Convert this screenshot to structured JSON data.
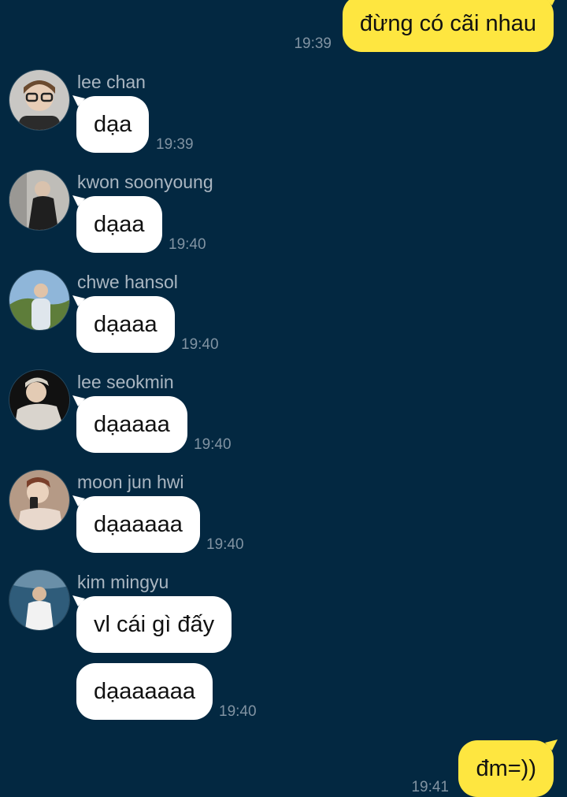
{
  "messages": [
    {
      "side": "out",
      "text": "đừng có cãi nhau",
      "time": "19:39"
    },
    {
      "side": "in",
      "sender": "lee chan",
      "avatar": "avatar-lee-chan",
      "bubbles": [
        "dạa"
      ],
      "time": "19:39",
      "avatar_colors": [
        "#c9c7c4",
        "#2b2b2b"
      ]
    },
    {
      "side": "in",
      "sender": "kwon soonyoung",
      "avatar": "avatar-kwon-soonyoung",
      "bubbles": [
        "dạaa"
      ],
      "time": "19:40",
      "avatar_colors": [
        "#bfbdb8",
        "#1f1f1f"
      ]
    },
    {
      "side": "in",
      "sender": "chwe hansol",
      "avatar": "avatar-chwe-hansol",
      "bubbles": [
        "dạaaa"
      ],
      "time": "19:40",
      "avatar_colors": [
        "#8fb6d9",
        "#5e7d3a"
      ]
    },
    {
      "side": "in",
      "sender": "lee seokmin",
      "avatar": "avatar-lee-seokmin",
      "bubbles": [
        "dạaaaa"
      ],
      "time": "19:40",
      "avatar_colors": [
        "#111111",
        "#d9d4cd"
      ]
    },
    {
      "side": "in",
      "sender": "moon jun hwi",
      "avatar": "avatar-moon-jun-hwi",
      "bubbles": [
        "dạaaaaa"
      ],
      "time": "19:40",
      "avatar_colors": [
        "#b59a86",
        "#e8d8cc"
      ]
    },
    {
      "side": "in",
      "sender": "kim mingyu",
      "avatar": "avatar-kim-mingyu",
      "bubbles": [
        "vl cái gì đấy",
        "dạaaaaaa"
      ],
      "time": "19:40",
      "avatar_colors": [
        "#2f5c7a",
        "#f2f2f2"
      ]
    },
    {
      "side": "out",
      "text": "đm=))",
      "time": "19:41"
    }
  ],
  "colors": {
    "background": "#032841",
    "incoming": "#ffffff",
    "outgoing": "#fee640",
    "time": "#8193a2",
    "sender": "#aab6c1"
  }
}
